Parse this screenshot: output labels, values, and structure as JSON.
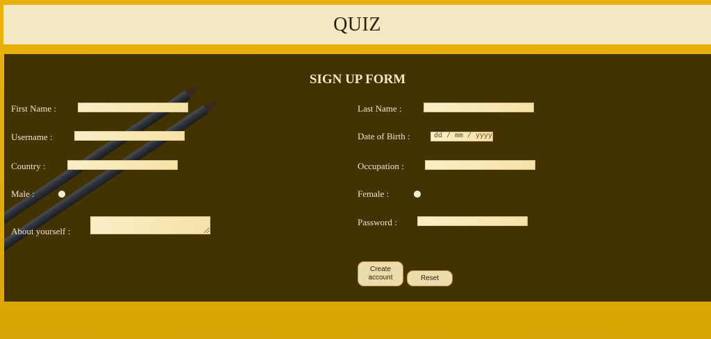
{
  "header": {
    "title": "QUIZ"
  },
  "form": {
    "title": "SIGN UP FORM",
    "left": {
      "first_name_label": "First Name :",
      "username_label": "Username :",
      "country_label": "Country :",
      "male_label": "Male :",
      "about_label": "About yourself :"
    },
    "right": {
      "last_name_label": "Last Name :",
      "dob_label": "Date of Birth :",
      "dob_placeholder": "dd / mm / yyyy",
      "occupation_label": "Occupation :",
      "female_label": "Female :",
      "password_label": "Password :"
    },
    "buttons": {
      "create_label": "Create account",
      "reset_label": "Reset"
    }
  },
  "colors": {
    "page_background": "#e0ac08",
    "header_background": "#f5e9c4",
    "panel_background": "#433300",
    "input_background": "#f6e2a6",
    "button_background": "#ecdcab"
  }
}
